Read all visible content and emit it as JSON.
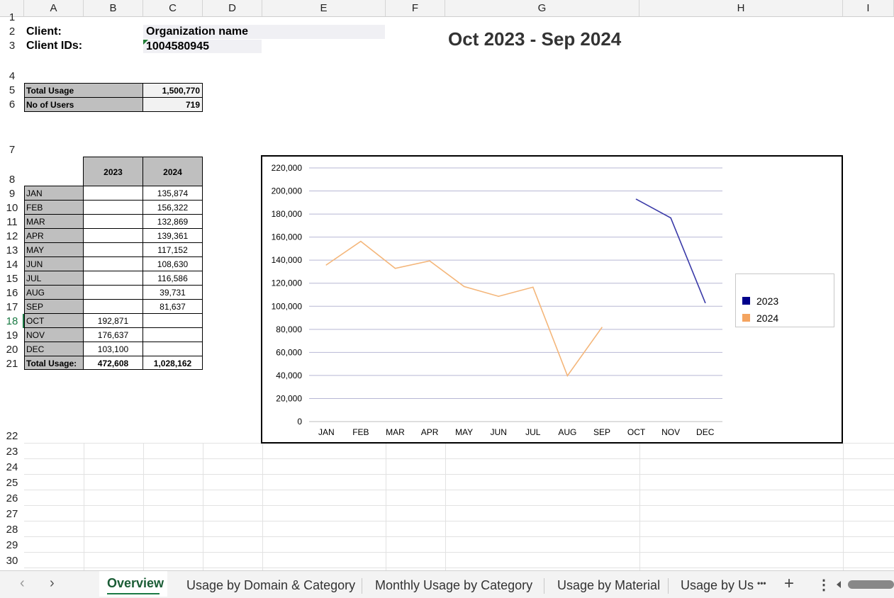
{
  "columns": [
    "A",
    "B",
    "C",
    "D",
    "E",
    "F",
    "G",
    "H",
    "I"
  ],
  "rows": [
    "1",
    "2",
    "3",
    "4",
    "5",
    "6",
    "7",
    "8",
    "9",
    "10",
    "11",
    "12",
    "13",
    "14",
    "15",
    "16",
    "17",
    "18",
    "19",
    "20",
    "21",
    "22",
    "23",
    "24",
    "25",
    "26",
    "27",
    "28",
    "29",
    "30"
  ],
  "header": {
    "client_label": "Client:",
    "client_value": "Organization name",
    "client_ids_label": "Client IDs:",
    "client_ids_value": "1004580945",
    "period_title": "Oct 2023 - Sep 2024"
  },
  "summary": {
    "total_usage_label": "Total Usage",
    "total_usage_value": "1,500,770",
    "users_label": "No of Users",
    "users_value": "719"
  },
  "monthly_table": {
    "year_headers": [
      "2023",
      "2024"
    ],
    "rows": [
      {
        "month": "JAN",
        "y2023": "",
        "y2024": "135,874"
      },
      {
        "month": "FEB",
        "y2023": "",
        "y2024": "156,322"
      },
      {
        "month": "MAR",
        "y2023": "",
        "y2024": "132,869"
      },
      {
        "month": "APR",
        "y2023": "",
        "y2024": "139,361"
      },
      {
        "month": "MAY",
        "y2023": "",
        "y2024": "117,152"
      },
      {
        "month": "JUN",
        "y2023": "",
        "y2024": "108,630"
      },
      {
        "month": "JUL",
        "y2023": "",
        "y2024": "116,586"
      },
      {
        "month": "AUG",
        "y2023": "",
        "y2024": "39,731"
      },
      {
        "month": "SEP",
        "y2023": "",
        "y2024": "81,637"
      },
      {
        "month": "OCT",
        "y2023": "192,871",
        "y2024": ""
      },
      {
        "month": "NOV",
        "y2023": "176,637",
        "y2024": ""
      },
      {
        "month": "DEC",
        "y2023": "103,100",
        "y2024": ""
      }
    ],
    "total_label": "Total Usage:",
    "total_2023": "472,608",
    "total_2024": "1,028,162"
  },
  "chart_data": {
    "type": "line",
    "categories": [
      "JAN",
      "FEB",
      "MAR",
      "APR",
      "MAY",
      "JUN",
      "JUL",
      "AUG",
      "SEP",
      "OCT",
      "NOV",
      "DEC"
    ],
    "series": [
      {
        "name": "2023",
        "color": "#3a3aa8",
        "legend_color": "#00008b",
        "values": [
          null,
          null,
          null,
          null,
          null,
          null,
          null,
          null,
          null,
          192871,
          176637,
          103100
        ]
      },
      {
        "name": "2024",
        "color": "#f4b67a",
        "legend_color": "#f4a460",
        "values": [
          135874,
          156322,
          132869,
          139361,
          117152,
          108630,
          116586,
          39731,
          81637,
          null,
          null,
          null
        ]
      }
    ],
    "ylim": [
      0,
      220000
    ],
    "yticks": [
      0,
      20000,
      40000,
      60000,
      80000,
      100000,
      120000,
      140000,
      160000,
      180000,
      200000,
      220000
    ],
    "ytick_labels": [
      "0",
      "20,000",
      "40,000",
      "60,000",
      "80,000",
      "100,000",
      "120,000",
      "140,000",
      "160,000",
      "180,000",
      "200,000",
      "220,000"
    ],
    "grid": true,
    "legend_position": "right"
  },
  "sheet_tabs": {
    "tabs": [
      "Overview",
      "Usage by Domain & Category",
      "Monthly Usage by Category",
      "Usage by Material",
      "Usage by Us"
    ],
    "active": "Overview",
    "more": "•••",
    "add": "+",
    "menu": "⋮"
  }
}
